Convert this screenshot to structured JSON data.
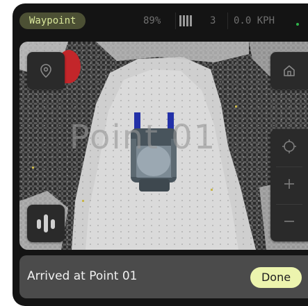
{
  "status_bar": {
    "mode": "Waypoint",
    "battery": "89%",
    "signal_bars_icon": "signal-strength-icon",
    "signal": "3",
    "speed": "0.0 KPH",
    "connection_color": "#2fb34a"
  },
  "map": {
    "overlay_label": "Point 01",
    "buttons": {
      "waypoint": "map-pin-icon",
      "home": "home-icon",
      "recenter": "crosshair-icon",
      "zoom_in": "plus-icon",
      "zoom_out": "minus-icon",
      "audio": "audio-bars-icon"
    }
  },
  "notice": {
    "message": "Arrived at Point 01",
    "action_label": "Done"
  },
  "colors": {
    "accent": "#d9e79a",
    "done_button": "#ecf4ae",
    "marker": "#c3262a",
    "robot_tracks": "#2230a8"
  }
}
